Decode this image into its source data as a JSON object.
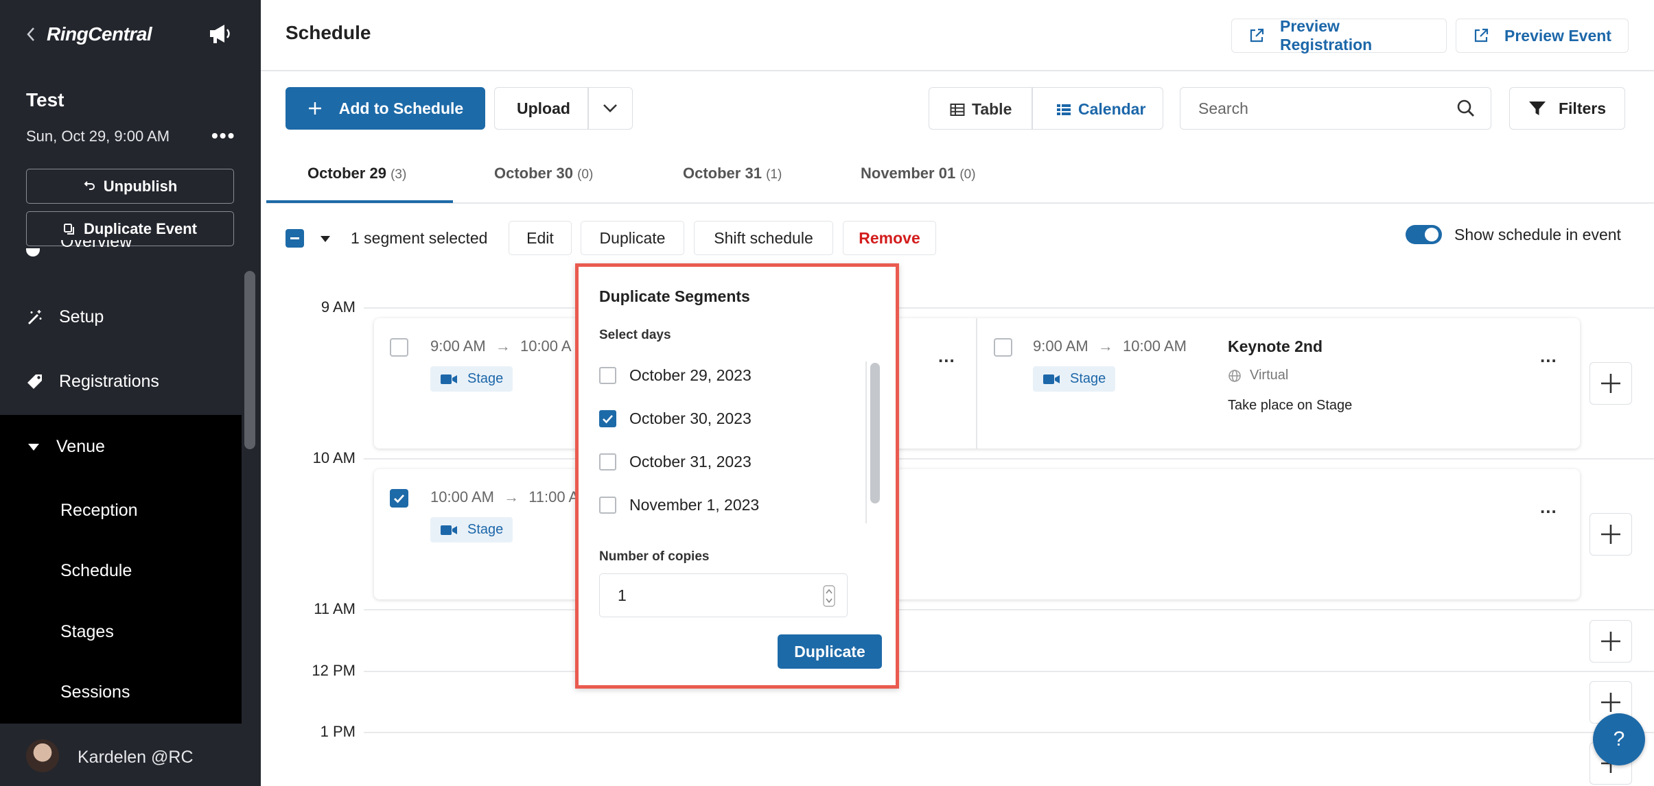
{
  "sidebar": {
    "brand": "RingCentral",
    "event_name": "Test",
    "event_date": "Sun, Oct 29, 9:00 AM",
    "unpublish_label": "Unpublish",
    "duplicate_event_label": "Duplicate Event",
    "partial_item": "Overview",
    "items": [
      {
        "label": "Setup",
        "icon": "magic-wand-icon"
      },
      {
        "label": "Registrations",
        "icon": "tag-icon"
      },
      {
        "label": "Venue",
        "icon": "caret-down-icon"
      }
    ],
    "venue_items": [
      "Reception",
      "Schedule",
      "Stages",
      "Sessions"
    ],
    "user_name": "Kardelen @RC"
  },
  "header": {
    "title": "Schedule",
    "preview_registration": "Preview Registration",
    "preview_event": "Preview Event"
  },
  "toolbar": {
    "add_label": "Add to Schedule",
    "upload_label": "Upload",
    "table_label": "Table",
    "calendar_label": "Calendar",
    "search_placeholder": "Search",
    "filters_label": "Filters"
  },
  "tabs": [
    {
      "label": "October 29",
      "count": "(3)",
      "active": true
    },
    {
      "label": "October 30",
      "count": "(0)",
      "active": false
    },
    {
      "label": "October 31",
      "count": "(1)",
      "active": false
    },
    {
      "label": "November 01",
      "count": "(0)",
      "active": false
    }
  ],
  "selection_bar": {
    "selected_text": "1 segment selected",
    "edit": "Edit",
    "duplicate": "Duplicate",
    "shift": "Shift schedule",
    "remove": "Remove",
    "show_toggle_label": "Show schedule in event",
    "show_toggle_on": true
  },
  "times": [
    "9 AM",
    "10 AM",
    "11 AM",
    "12 PM",
    "1 PM"
  ],
  "segments": [
    {
      "start": "9:00 AM",
      "end": "10:00 A",
      "stage": "Stage",
      "checked": false
    },
    {
      "start": "9:00 AM",
      "end": "10:00 AM",
      "stage": "Stage",
      "title": "Keynote 2nd",
      "location": "Virtual",
      "description": "Take place on Stage",
      "checked": false
    },
    {
      "start": "10:00 AM",
      "end": "11:00 A",
      "stage": "Stage",
      "checked": true
    }
  ],
  "popup": {
    "title": "Duplicate Segments",
    "select_days_label": "Select days",
    "days": [
      {
        "label": "October 29, 2023",
        "checked": false
      },
      {
        "label": "October 30, 2023",
        "checked": true
      },
      {
        "label": "October 31, 2023",
        "checked": false
      },
      {
        "label": "November 1, 2023",
        "checked": false
      }
    ],
    "copies_label": "Number of copies",
    "copies_value": "1",
    "submit_label": "Duplicate"
  },
  "help_label": "?",
  "colors": {
    "primary": "#1d6aa8",
    "danger": "#d31c1c",
    "highlight": "#ea5a4f",
    "sidebar": "#23262d"
  }
}
